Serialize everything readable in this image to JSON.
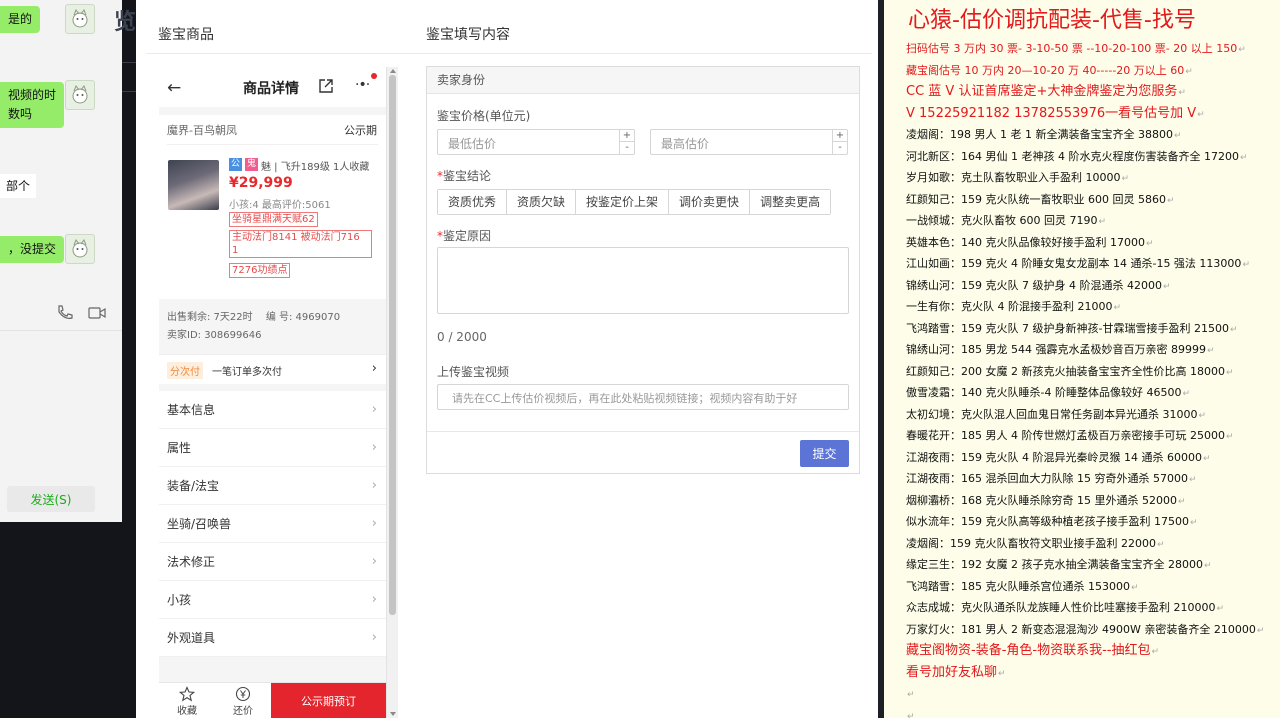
{
  "chat": {
    "messages": [
      {
        "text": "是的"
      },
      {
        "text": "视频的时\n数吗"
      },
      {
        "text": "部个"
      },
      {
        "text": "，没提交"
      }
    ],
    "send_label": "发送(S)"
  },
  "left_header": {
    "goods_title": "鉴宝商品",
    "form_title": "鉴宝填写内容"
  },
  "product": {
    "header_title": "商品详情",
    "server": "魔界-百鸟朝凤",
    "public_label": "公示期",
    "tag_public": "公",
    "tag_ghost": "鬼",
    "character": "魅 | 飞升189级  1人收藏",
    "price": "¥29,999",
    "child_info": "小孩:4  最高评价:5061",
    "tags": [
      "坐骑星鼎满天赋62",
      "主动法门8141 被动法门716\n1",
      "7276功绩点"
    ],
    "sale_remaining": "出售剩余: 7天22时",
    "serial": "编  号: 4969070",
    "seller_id": "卖家ID: 308699646",
    "installment_badge": "分次付",
    "installment_text": "一笔订单多次付",
    "menu": [
      "基本信息",
      "属性",
      "装备/法宝",
      "坐骑/召唤兽",
      "法术修正",
      "小孩",
      "外观道具"
    ],
    "footer": {
      "fav": "收藏",
      "bargain": "还价",
      "book": "公示期预订"
    }
  },
  "form": {
    "section": "卖家身份",
    "price_label": "鉴宝价格(单位元)",
    "min_placeholder": "最低估价",
    "max_placeholder": "最高估价",
    "conclusion_label": "鉴宝结论",
    "options": [
      "资质优秀",
      "资质欠缺",
      "按鉴定价上架",
      "调价卖更快",
      "调整卖更高"
    ],
    "reason_label": "鉴定原因",
    "char_count": "0 / 2000",
    "video_label": "上传鉴宝视频",
    "video_placeholder": "请先在CC上传估价视频后，再在此处粘贴视频链接；视频内容有助于好",
    "submit": "提交"
  },
  "notes": {
    "headline": "心猿-估价调抗配装-代售-找号",
    "red_lines": [
      "扫码估号 3 万内 30 票- 3-10-50 票  --10-20-100 票- 20 以上 150",
      "藏宝阁估号 10 万内 20—10-20 万 40-----20 万以上 60",
      "CC 蓝 V 认证首席鉴定+大神金牌鉴定为您服务",
      "V 15225921182       13782553976一看号估号加 V"
    ],
    "entries": [
      {
        "name": "凌烟阁：",
        "detail": "198 男人 1 老 1 新全满装备宝宝齐全 38800"
      },
      {
        "name": "河北新区：",
        "detail": "164 男仙 1 老神孩 4 阶水克火程度伤害装备齐全 17200"
      },
      {
        "name": "岁月如歌：",
        "detail": "克土队畜牧职业入手盈利 10000"
      },
      {
        "name": "红颜知己：",
        "detail": "159 克火队统一畜牧职业 600 回灵 5860"
      },
      {
        "name": "一战倾城：",
        "detail": "克火队畜牧 600 回灵 7190"
      },
      {
        "name": "英雄本色：",
        "detail": "140 克火队品像较好接手盈利 17000"
      },
      {
        "name": "江山如画：",
        "detail": "159 克火 4 阶睡女鬼女龙副本 14 通杀-15 强法 113000"
      },
      {
        "name": "锦绣山河：",
        "detail": "159 克火队 7 级护身 4 阶混通杀 42000"
      },
      {
        "name": "一生有你：",
        "detail": "克火队 4 阶混接手盈利 21000"
      },
      {
        "name": "飞鸿踏雪：",
        "detail": "159 克火队 7 级护身新神孩-甘霖瑞雪接手盈利 21500"
      },
      {
        "name": "锦绣山河：",
        "detail": "185 男龙 544 强霹克水孟极妙音百万亲密 89999"
      },
      {
        "name": "红颜知己：",
        "detail": "200 女魔 2 新孩克火抽装备宝宝齐全性价比高 18000"
      },
      {
        "name": "傲雪凌霜：",
        "detail": "140 克火队睡杀-4 阶睡整体品像较好 46500"
      },
      {
        "name": "太初幻境：",
        "detail": "克火队混人回血鬼日常任务副本异光通杀 31000"
      },
      {
        "name": "春暖花开：",
        "detail": "185 男人 4 阶传世燃灯孟极百万亲密接手可玩 25000"
      },
      {
        "name": "江湖夜雨：",
        "detail": "159 克火队 4 阶混异光秦岭灵猴 14 通杀 60000"
      },
      {
        "name": "江湖夜雨：",
        "detail": "165 混杀回血大力队除 15 穷奇外通杀 57000"
      },
      {
        "name": "烟柳灞桥：",
        "detail": "168 克火队睡杀除穷奇 15 里外通杀 52000"
      },
      {
        "name": "似水流年：",
        "detail": "159 克火队高等级种植老孩子接手盈利 17500"
      },
      {
        "name": "凌烟阁：",
        "detail": "159 克火队畜牧符文职业接手盈利 22000"
      },
      {
        "name": "缘定三生：",
        "detail": "192 女魔 2 孩子克水抽全满装备宝宝齐全 28000"
      },
      {
        "name": "飞鸿踏雪：",
        "detail": "185 克火队睡杀宫位通杀 153000"
      },
      {
        "name": "众志成城：",
        "detail": "克火队通杀队龙族睡人性价比哇塞接手盈利 210000"
      },
      {
        "name": "万家灯火：",
        "detail": "181 男人 2 新变态混混淘沙 4900W 亲密装备齐全 210000"
      }
    ],
    "footer_lines": [
      "藏宝阁物资-装备-角色-物资联系我--抽红包",
      "看号加好友私聊"
    ],
    "para_mark": "↵"
  }
}
